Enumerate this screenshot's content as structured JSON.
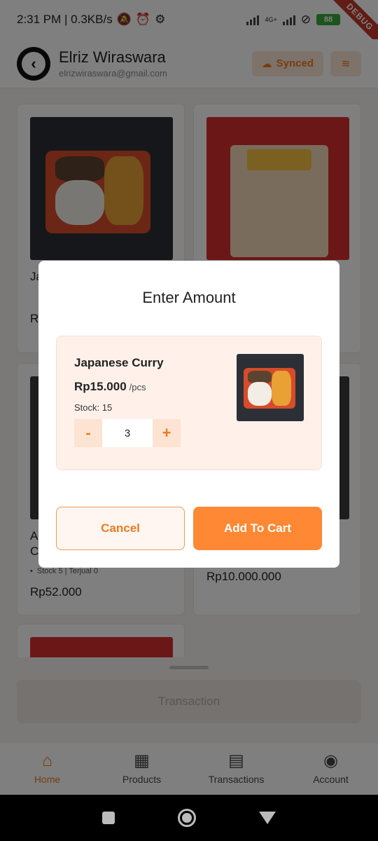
{
  "status_bar": {
    "time_info": "2:31 PM | 0.3KB/s",
    "network": "4G+",
    "battery": "88",
    "debug_banner": "DEBUG"
  },
  "header": {
    "user_name": "Elriz Wiraswara",
    "user_email": "elrizwiraswara@gmail.com",
    "synced_label": "Synced"
  },
  "products": [
    {
      "title": "Ja",
      "meta": "",
      "price": "R"
    },
    {
      "title": "",
      "meta": "",
      "price": ""
    },
    {
      "title_line1": "A",
      "title_line2": "C",
      "meta": "Stock 5 | Terjual 0",
      "price": "Rp52.000"
    },
    {
      "title": "",
      "meta": "",
      "price": "Rp10.000.000"
    }
  ],
  "dialog": {
    "title": "Enter Amount",
    "item_name": "Japanese Curry",
    "item_price": "Rp15.000",
    "item_unit": "/pcs",
    "item_stock": "Stock: 15",
    "quantity": "3",
    "minus_label": "-",
    "plus_label": "+",
    "cancel_label": "Cancel",
    "add_label": "Add To Cart"
  },
  "transaction_button": "Transaction",
  "bottom_nav": [
    {
      "label": "Home",
      "icon": "home-icon",
      "active": true
    },
    {
      "label": "Products",
      "icon": "products-icon",
      "active": false
    },
    {
      "label": "Transactions",
      "icon": "receipt-icon",
      "active": false
    },
    {
      "label": "Account",
      "icon": "account-icon",
      "active": false
    }
  ],
  "colors": {
    "accent": "#ff8834",
    "accent_text": "#e87c23",
    "accent_light": "#fde3d2"
  }
}
